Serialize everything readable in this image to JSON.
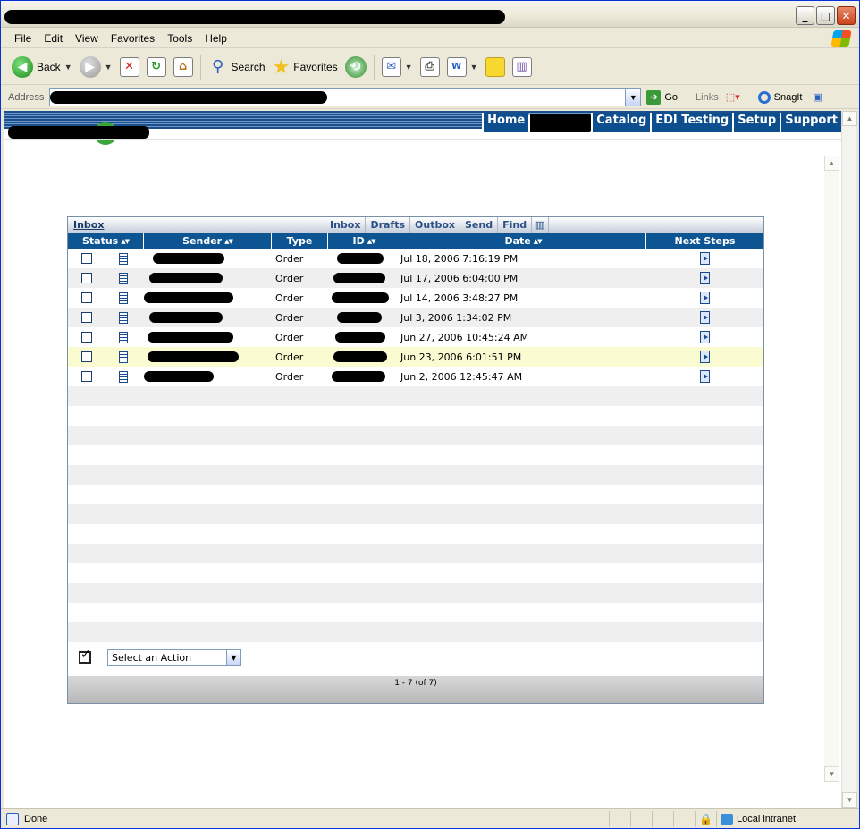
{
  "menu": [
    "File",
    "Edit",
    "View",
    "Favorites",
    "Tools",
    "Help"
  ],
  "toolbar": {
    "back": "Back",
    "search": "Search",
    "favorites": "Favorites"
  },
  "address": {
    "label": "Address",
    "go": "Go",
    "links": "Links",
    "snagit": "SnagIt"
  },
  "site_nav": [
    "Home",
    "Catalog",
    "EDI Testing",
    "Setup",
    "Support"
  ],
  "panel": {
    "title": "Inbox",
    "tabs": [
      "Inbox",
      "Drafts",
      "Outbox",
      "Send",
      "Find"
    ],
    "columns": [
      "Status",
      "Sender",
      "Type",
      "ID",
      "Date",
      "Next Steps"
    ]
  },
  "rows": [
    {
      "type": "Order",
      "date": "Jul 18, 2006 7:16:19 PM"
    },
    {
      "type": "Order",
      "date": "Jul 17, 2006 6:04:00 PM"
    },
    {
      "type": "Order",
      "date": "Jul 14, 2006 3:48:27 PM"
    },
    {
      "type": "Order",
      "date": "Jul 3, 2006 1:34:02 PM"
    },
    {
      "type": "Order",
      "date": "Jun 27, 2006 10:45:24 AM"
    },
    {
      "type": "Order",
      "date": "Jun 23, 2006 6:01:51 PM"
    },
    {
      "type": "Order",
      "date": "Jun 2, 2006 12:45:47 AM"
    }
  ],
  "action": {
    "select_label": "Select an Action"
  },
  "pager": "1 - 7 (of 7)",
  "status": {
    "text": "Done",
    "zone": "Local intranet"
  }
}
